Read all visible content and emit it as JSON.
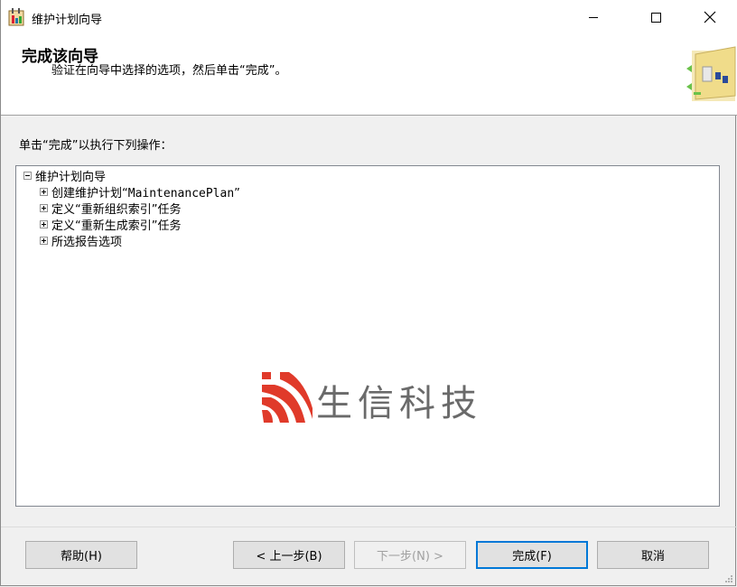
{
  "window": {
    "title": "维护计划向导",
    "icon": "wizard-app-icon",
    "controls": {
      "minimize": "minimize-icon",
      "maximize": "maximize-icon",
      "close": "close-icon"
    }
  },
  "header": {
    "title": "完成该向导",
    "subtitle": "验证在向导中选择的选项，然后单击“完成”。"
  },
  "main": {
    "instruction": "单击“完成”以执行下列操作：",
    "tree": {
      "root": {
        "label": "维护计划向导",
        "expanded": true
      },
      "children": [
        {
          "label_prefix": "创建维护计划“",
          "label_name": "MaintenancePlan",
          "label_suffix": "”"
        },
        {
          "label": "定义“重新组织索引”任务"
        },
        {
          "label": "定义“重新生成索引”任务"
        },
        {
          "label": "所选报告选项"
        }
      ]
    },
    "watermark": {
      "text": "生信科技",
      "colors": {
        "logo": "#e03a2a",
        "text": "#6a6a6a"
      }
    }
  },
  "footer": {
    "help": "帮助(H)",
    "back": "< 上一步(B)",
    "next": "下一步(N) >",
    "finish": "完成(F)",
    "cancel": "取消"
  },
  "colors": {
    "accent": "#0078d7",
    "window_bg": "#f0f0f0",
    "header_bg": "#ffffff"
  }
}
